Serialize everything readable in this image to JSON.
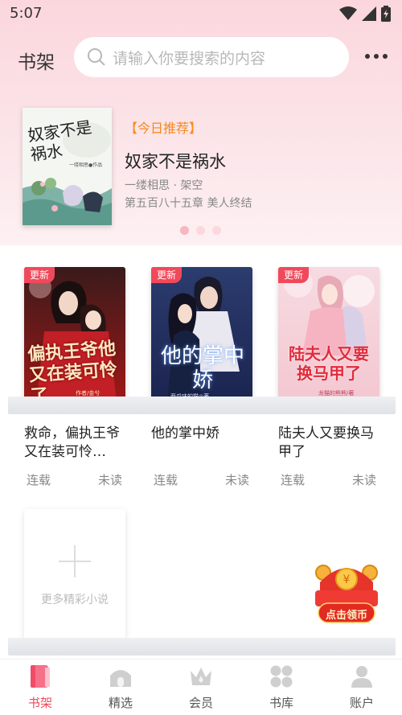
{
  "status_bar": {
    "time": "5:07"
  },
  "header": {
    "title": "书架",
    "search_placeholder": "请输入你要搜索的内容"
  },
  "banner": {
    "tag": "【今日推荐】",
    "title": "奴家不是祸水",
    "author_line": "一缕相思 · 架空",
    "chapter_line": "第五百八十五章 美人终结",
    "cover_text": "奴家不是祸水",
    "cover_subtext": "一缕相思●作品",
    "pages": 3,
    "active_page": 1
  },
  "books": [
    {
      "badge": "更新",
      "title": "救命，偏执王爷又在装可怜…",
      "status": "连载",
      "read_state": "未读",
      "cover_text": "偏执王爷他又在装可怜了",
      "cover_small": "作者/金兮"
    },
    {
      "badge": "更新",
      "title": "他的掌中娇",
      "status": "连载",
      "read_state": "未读",
      "cover_text": "他的掌中娇",
      "cover_small": "西瓜味的猫◎著"
    },
    {
      "badge": "更新",
      "title": "陆夫人又要换马甲了",
      "status": "连载",
      "read_state": "未读",
      "cover_text": "陆夫人又要换马甲了",
      "cover_small": "龙猫的熊熊/著"
    }
  ],
  "more_card": {
    "label": "更多精彩小说"
  },
  "redpacket": {
    "label": "点击领币"
  },
  "nav": [
    {
      "label": "书架",
      "icon": "bookshelf-icon",
      "active": true
    },
    {
      "label": "精选",
      "icon": "featured-icon",
      "active": false
    },
    {
      "label": "会员",
      "icon": "crown-icon",
      "active": false
    },
    {
      "label": "书库",
      "icon": "library-icon",
      "active": false
    },
    {
      "label": "账户",
      "icon": "account-icon",
      "active": false
    }
  ],
  "colors": {
    "accent": "#f0495b",
    "tag": "#f5891e",
    "header_bg": "#fbd6dd"
  }
}
